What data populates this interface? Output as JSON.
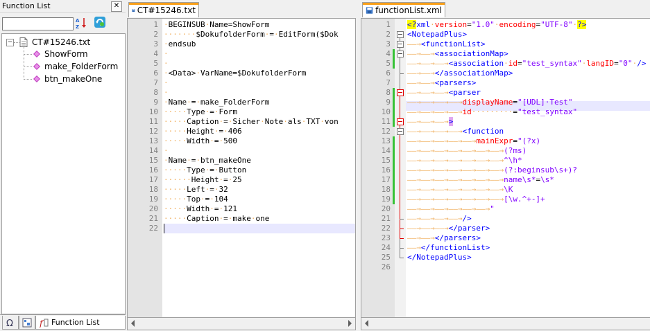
{
  "function_list": {
    "title": "Function List",
    "close_label": "✕",
    "search_value": "",
    "tree": {
      "root": "CT#15246.txt",
      "items": [
        "ShowForm",
        "make_FolderForm",
        "btn_makeOne"
      ]
    },
    "bottom_tab_label": "Function List"
  },
  "editor_left": {
    "tab_label": "CT#15246.txt",
    "line_numbers": [
      "1",
      "2",
      "3",
      "4",
      "5",
      "6",
      "7",
      "8",
      "9",
      "10",
      "11",
      "12",
      "13",
      "14",
      "15",
      "16",
      "17",
      "18",
      "19",
      "20",
      "21",
      "22"
    ],
    "lines": [
      "·BEGINSUB·Name=ShowForm",
      "·······$DokufolderForm·=·EditForm($Dok",
      "·endsub",
      "·",
      "·",
      "·<Data>·VarName=$DokufolderForm",
      "·",
      "·",
      "·Name·=·make_FolderForm",
      "·····Type·=·Form",
      "·····Caption·=·Sicher·Note·als·TXT·von",
      "·····Height·=·406",
      "·····Width·=·500",
      "·",
      "·Name·=·btn_makeOne",
      "·····Type·=·Button",
      "······Height·=·25",
      "·····Left·=·32",
      "·····Top·=·104",
      "·····Width·=·121",
      "·····Caption·=·make·one",
      ""
    ]
  },
  "editor_right": {
    "tab_label": "functionList.xml",
    "line_numbers": [
      "1",
      "2",
      "3",
      "4",
      "5",
      "6",
      "7",
      "8",
      "9",
      "10",
      "11",
      "12",
      "13",
      "14",
      "15",
      "16",
      "17",
      "18",
      "19",
      "20",
      "21",
      "22",
      "23",
      "24",
      "25",
      "26"
    ],
    "lines": [
      "<?xml·version=\"1.0\"·encoding=\"UTF-8\"·?>",
      "<NotepadPlus>",
      "——→<functionList>",
      "——→——→<associationMap>",
      "——→——→——→<association·id=\"test_syntax\"·langID=\"0\"·/>",
      "——→——→</associationMap>",
      "——→——→<parsers>",
      "——→——→——→<parser",
      "——→——→——→——→displayName=\"[UDL]·Test\"",
      "——→——→——→——→id·········=\"test_syntax\"",
      "——→——→——→>",
      "——→——→——→——→<function",
      "——→——→——→——→——→mainExpr=\"(?x)",
      "——→——→——→——→——→——→——→(?ms)",
      "——→——→——→——→——→——→——→^\\h*",
      "——→——→——→——→——→——→——→(?:beginsub\\s+)?",
      "——→——→——→——→——→——→——→name\\s*=\\s*",
      "——→——→——→——→——→——→——→\\K",
      "——→——→——→——→——→——→——→[\\w.^+-]+",
      "——→——→——→——→——→——→\"",
      "——→——→——→——→/>",
      "——→——→——→</parser>",
      "——→——→</parsers>",
      "——→</functionList>",
      "</NotepadPlus>",
      ""
    ]
  },
  "colors": {
    "tag": "#0000ff",
    "attr": "#ff0000",
    "value": "#8000ff",
    "text": "#000000",
    "whitespace": "#f0b060",
    "tab_accent": "#f9a01a",
    "fold_red": "#e00000",
    "change_green": "#36c236"
  }
}
